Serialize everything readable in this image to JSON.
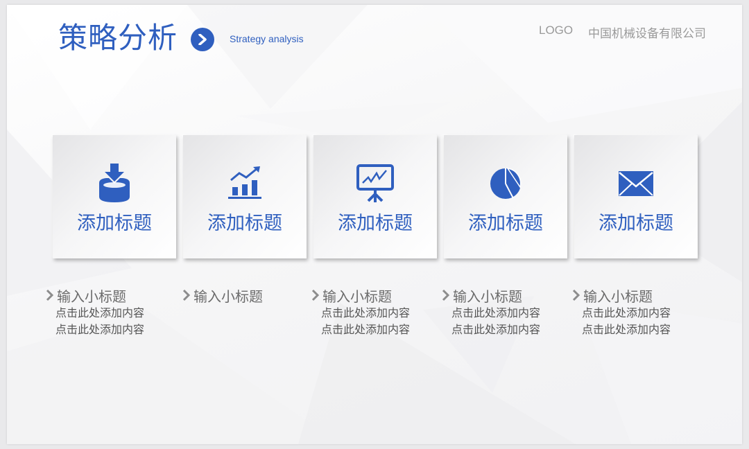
{
  "header": {
    "title": "策略分析",
    "subtitle": "Strategy analysis",
    "logo": "LOGO",
    "company": "中国机械设备有限公司"
  },
  "colors": {
    "accent": "#2f5fbf",
    "muted": "#9a9a9a"
  },
  "cards": [
    {
      "icon": "download-tray-icon",
      "title": "添加标题"
    },
    {
      "icon": "bar-chart-growth-icon",
      "title": "添加标题"
    },
    {
      "icon": "presentation-board-icon",
      "title": "添加标题"
    },
    {
      "icon": "pie-chart-icon",
      "title": "添加标题"
    },
    {
      "icon": "envelope-icon",
      "title": "添加标题"
    }
  ],
  "columns": [
    {
      "subtitle": "输入小标题",
      "lines": [
        "点击此处添加内容",
        "点击此处添加内容"
      ]
    },
    {
      "subtitle": "输入小标题",
      "lines": []
    },
    {
      "subtitle": "输入小标题",
      "lines": [
        "点击此处添加内容",
        "点击此处添加内容"
      ]
    },
    {
      "subtitle": "输入小标题",
      "lines": [
        "点击此处添加内容",
        "点击此处添加内容"
      ]
    },
    {
      "subtitle": "输入小标题",
      "lines": [
        "点击此处添加内容",
        "点击此处添加内容"
      ]
    }
  ]
}
